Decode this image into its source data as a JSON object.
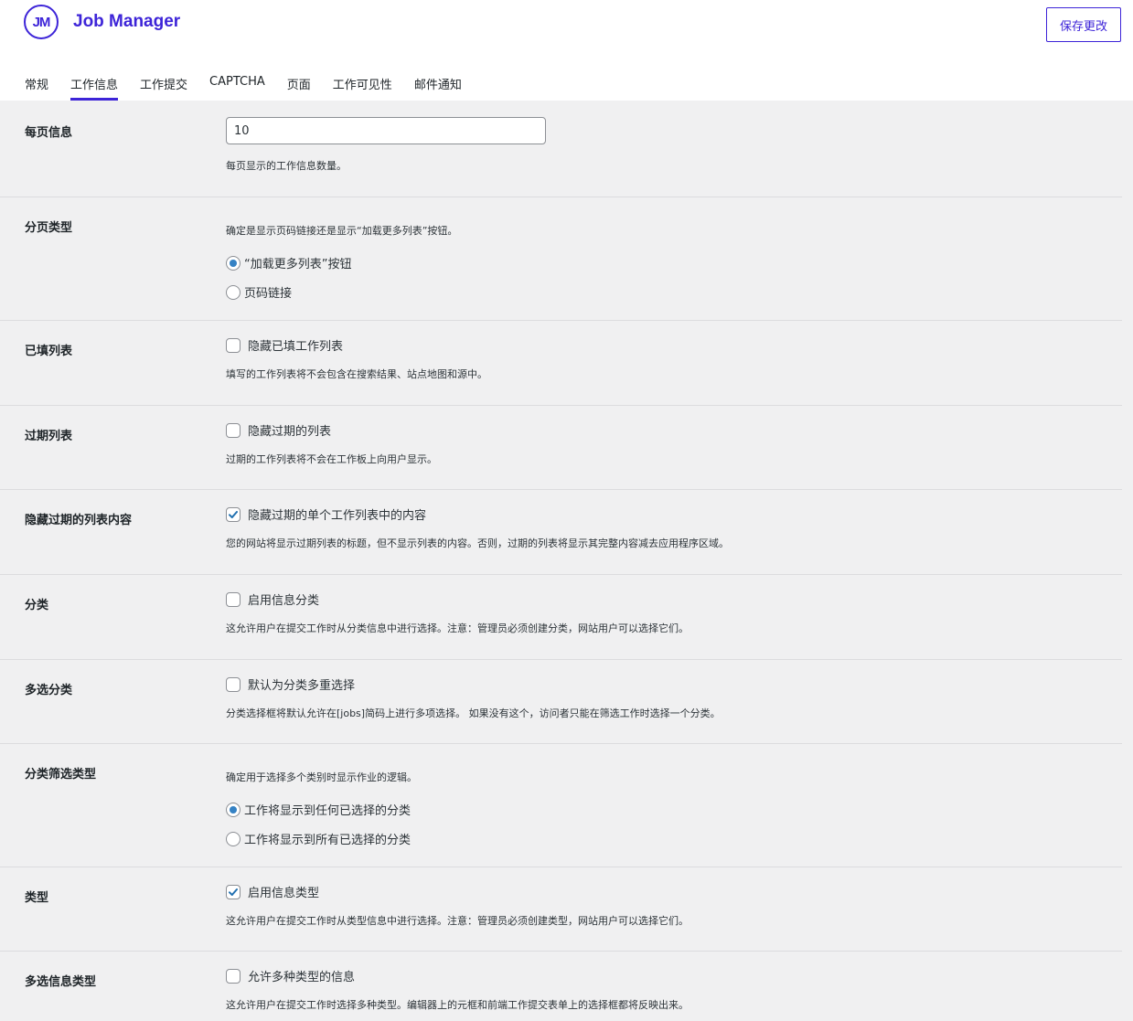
{
  "header": {
    "logo_text": "JM",
    "brand_name": "Job Manager",
    "save_label": "保存更改"
  },
  "tabs": [
    {
      "label": "常规",
      "active": false
    },
    {
      "label": "工作信息",
      "active": true
    },
    {
      "label": "工作提交",
      "active": false
    },
    {
      "label": "CAPTCHA",
      "active": false
    },
    {
      "label": "页面",
      "active": false
    },
    {
      "label": "工作可见性",
      "active": false
    },
    {
      "label": "邮件通知",
      "active": false
    }
  ],
  "settings": {
    "per_page": {
      "label": "每页信息",
      "value": "10",
      "desc": "每页显示的工作信息数量。"
    },
    "pagination": {
      "label": "分页类型",
      "desc": "确定是显示页码链接还是显示“加载更多列表”按钮。",
      "options": [
        {
          "label": "“加载更多列表”按钮",
          "selected": true
        },
        {
          "label": "页码链接",
          "selected": false
        }
      ]
    },
    "filled": {
      "label": "已填列表",
      "checkbox_label": "隐藏已填工作列表",
      "checked": false,
      "desc": "填写的工作列表将不会包含在搜索结果、站点地图和源中。"
    },
    "expired": {
      "label": "过期列表",
      "checkbox_label": "隐藏过期的列表",
      "checked": false,
      "desc": "过期的工作列表将不会在工作板上向用户显示。"
    },
    "expired_content": {
      "label": "隐藏过期的列表内容",
      "checkbox_label": "隐藏过期的单个工作列表中的内容",
      "checked": true,
      "desc": "您的网站将显示过期列表的标题，但不显示列表的内容。否则，过期的列表将显示其完整内容减去应用程序区域。"
    },
    "categories": {
      "label": "分类",
      "checkbox_label": "启用信息分类",
      "checked": false,
      "desc": "这允许用户在提交工作时从分类信息中进行选择。注意：管理员必须创建分类，网站用户可以选择它们。"
    },
    "multi_category": {
      "label": "多选分类",
      "checkbox_label": "默认为分类多重选择",
      "checked": false,
      "desc": "分类选择框将默认允许在[jobs]简码上进行多项选择。 如果没有这个，访问者只能在筛选工作时选择一个分类。"
    },
    "category_filter": {
      "label": "分类筛选类型",
      "desc": "确定用于选择多个类别时显示作业的逻辑。",
      "options": [
        {
          "label": "工作将显示到任何已选择的分类",
          "selected": true
        },
        {
          "label": "工作将显示到所有已选择的分类",
          "selected": false
        }
      ]
    },
    "types": {
      "label": "类型",
      "checkbox_label": "启用信息类型",
      "checked": true,
      "desc": "这允许用户在提交工作时从类型信息中进行选择。注意：管理员必须创建类型，网站用户可以选择它们。"
    },
    "multi_type": {
      "label": "多选信息类型",
      "checkbox_label": "允许多种类型的信息",
      "checked": false,
      "desc": "这允许用户在提交工作时选择多种类型。编辑器上的元框和前端工作提交表单上的选择框都将反映出来。"
    }
  },
  "colors": {
    "brand": "#3d24d8",
    "checkbox_check": "#2271b1",
    "radio_dot": "#3582c4"
  }
}
